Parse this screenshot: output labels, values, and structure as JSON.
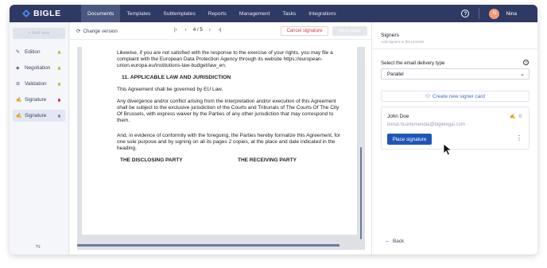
{
  "app": {
    "logo_text": "BIGLE"
  },
  "topnav": {
    "items": [
      {
        "label": "Documents"
      },
      {
        "label": "Templates"
      },
      {
        "label": "Subtemplates"
      },
      {
        "label": "Reports"
      },
      {
        "label": "Management"
      },
      {
        "label": "Tasks"
      },
      {
        "label": "Integrations"
      }
    ],
    "active_index": 0,
    "user_initial": "N",
    "user_name": "Nina"
  },
  "sidebar": {
    "add_step_label": "+ Add step",
    "steps": [
      {
        "label": "Edition",
        "icon": "edit-icon",
        "status_color": "#a7c93c"
      },
      {
        "label": "Negotiation",
        "icon": "tag-icon",
        "status_color": "#a7c93c"
      },
      {
        "label": "Validation",
        "icon": "check-circle-icon",
        "status_color": "#a7c93c"
      },
      {
        "label": "Signature",
        "icon": "signature-icon",
        "status_color": "#d33a3a"
      },
      {
        "label": "Signature",
        "icon": "signature-icon",
        "status_color": "#7f8db5"
      }
    ],
    "active_index": 4
  },
  "toolbar": {
    "change_version_label": "Change version",
    "page_indicator": "4 / 5",
    "cancel_signature_label": "Cancel signature",
    "next_stage_label": "Next stage"
  },
  "document": {
    "para1": "Likewise, if you are not satisfied with the response to the exercise of your rights, you may file a complaint with the European Data Protection Agency through its website https://european-union.europa.eu/institutions-law-budget/law_en.",
    "heading": "11. APPLICABLE LAW AND JURISDICTION",
    "para2": "This Agreement shall be governed by EU Law.",
    "para3": "Any divergence and/or conflict arising from the interpretation and/or execution of this Agreement shall be subject to the exclusive jurisdiction of the Courts and Tribunals of The Courts Of The City Of Brussels, with express waiver by the Parties of any other jurisdiction that may correspond to them.",
    "para4": "And, in evidence of conformity with the foregoing, the Parties hereby formalize this Agreement, for one sole purpose and by signing on all its pages 2 copies, at the place and date indicated in the heading.",
    "party1": "THE DISCLOSING PARTY",
    "party2": "THE RECEIVING PARTY"
  },
  "signers_panel": {
    "title": "Signers",
    "subtitle": "Add signers to the process",
    "delivery_label": "Select the email delivery type",
    "delivery_value": "Parallel",
    "create_signer_label": "Create new signer card",
    "signer": {
      "name": "John Doe",
      "email": "benat.huartemendia@biglelegal.com",
      "signature_count": "0",
      "place_signature_label": "Place signature"
    },
    "back_label": "Back"
  },
  "colors": {
    "nav_bg": "#2e3a63",
    "primary": "#1f57b8",
    "link": "#3e6ac9",
    "danger": "#d0383a"
  }
}
